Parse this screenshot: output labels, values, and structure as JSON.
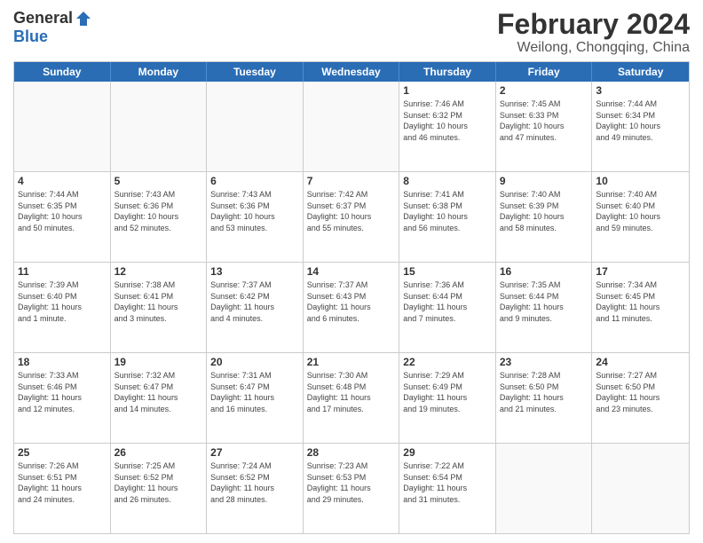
{
  "header": {
    "logo_general": "General",
    "logo_blue": "Blue",
    "title": "February 2024",
    "location": "Weilong, Chongqing, China"
  },
  "days_of_week": [
    "Sunday",
    "Monday",
    "Tuesday",
    "Wednesday",
    "Thursday",
    "Friday",
    "Saturday"
  ],
  "weeks": [
    [
      {
        "day": "",
        "info": ""
      },
      {
        "day": "",
        "info": ""
      },
      {
        "day": "",
        "info": ""
      },
      {
        "day": "",
        "info": ""
      },
      {
        "day": "1",
        "info": "Sunrise: 7:46 AM\nSunset: 6:32 PM\nDaylight: 10 hours\nand 46 minutes."
      },
      {
        "day": "2",
        "info": "Sunrise: 7:45 AM\nSunset: 6:33 PM\nDaylight: 10 hours\nand 47 minutes."
      },
      {
        "day": "3",
        "info": "Sunrise: 7:44 AM\nSunset: 6:34 PM\nDaylight: 10 hours\nand 49 minutes."
      }
    ],
    [
      {
        "day": "4",
        "info": "Sunrise: 7:44 AM\nSunset: 6:35 PM\nDaylight: 10 hours\nand 50 minutes."
      },
      {
        "day": "5",
        "info": "Sunrise: 7:43 AM\nSunset: 6:36 PM\nDaylight: 10 hours\nand 52 minutes."
      },
      {
        "day": "6",
        "info": "Sunrise: 7:43 AM\nSunset: 6:36 PM\nDaylight: 10 hours\nand 53 minutes."
      },
      {
        "day": "7",
        "info": "Sunrise: 7:42 AM\nSunset: 6:37 PM\nDaylight: 10 hours\nand 55 minutes."
      },
      {
        "day": "8",
        "info": "Sunrise: 7:41 AM\nSunset: 6:38 PM\nDaylight: 10 hours\nand 56 minutes."
      },
      {
        "day": "9",
        "info": "Sunrise: 7:40 AM\nSunset: 6:39 PM\nDaylight: 10 hours\nand 58 minutes."
      },
      {
        "day": "10",
        "info": "Sunrise: 7:40 AM\nSunset: 6:40 PM\nDaylight: 10 hours\nand 59 minutes."
      }
    ],
    [
      {
        "day": "11",
        "info": "Sunrise: 7:39 AM\nSunset: 6:40 PM\nDaylight: 11 hours\nand 1 minute."
      },
      {
        "day": "12",
        "info": "Sunrise: 7:38 AM\nSunset: 6:41 PM\nDaylight: 11 hours\nand 3 minutes."
      },
      {
        "day": "13",
        "info": "Sunrise: 7:37 AM\nSunset: 6:42 PM\nDaylight: 11 hours\nand 4 minutes."
      },
      {
        "day": "14",
        "info": "Sunrise: 7:37 AM\nSunset: 6:43 PM\nDaylight: 11 hours\nand 6 minutes."
      },
      {
        "day": "15",
        "info": "Sunrise: 7:36 AM\nSunset: 6:44 PM\nDaylight: 11 hours\nand 7 minutes."
      },
      {
        "day": "16",
        "info": "Sunrise: 7:35 AM\nSunset: 6:44 PM\nDaylight: 11 hours\nand 9 minutes."
      },
      {
        "day": "17",
        "info": "Sunrise: 7:34 AM\nSunset: 6:45 PM\nDaylight: 11 hours\nand 11 minutes."
      }
    ],
    [
      {
        "day": "18",
        "info": "Sunrise: 7:33 AM\nSunset: 6:46 PM\nDaylight: 11 hours\nand 12 minutes."
      },
      {
        "day": "19",
        "info": "Sunrise: 7:32 AM\nSunset: 6:47 PM\nDaylight: 11 hours\nand 14 minutes."
      },
      {
        "day": "20",
        "info": "Sunrise: 7:31 AM\nSunset: 6:47 PM\nDaylight: 11 hours\nand 16 minutes."
      },
      {
        "day": "21",
        "info": "Sunrise: 7:30 AM\nSunset: 6:48 PM\nDaylight: 11 hours\nand 17 minutes."
      },
      {
        "day": "22",
        "info": "Sunrise: 7:29 AM\nSunset: 6:49 PM\nDaylight: 11 hours\nand 19 minutes."
      },
      {
        "day": "23",
        "info": "Sunrise: 7:28 AM\nSunset: 6:50 PM\nDaylight: 11 hours\nand 21 minutes."
      },
      {
        "day": "24",
        "info": "Sunrise: 7:27 AM\nSunset: 6:50 PM\nDaylight: 11 hours\nand 23 minutes."
      }
    ],
    [
      {
        "day": "25",
        "info": "Sunrise: 7:26 AM\nSunset: 6:51 PM\nDaylight: 11 hours\nand 24 minutes."
      },
      {
        "day": "26",
        "info": "Sunrise: 7:25 AM\nSunset: 6:52 PM\nDaylight: 11 hours\nand 26 minutes."
      },
      {
        "day": "27",
        "info": "Sunrise: 7:24 AM\nSunset: 6:52 PM\nDaylight: 11 hours\nand 28 minutes."
      },
      {
        "day": "28",
        "info": "Sunrise: 7:23 AM\nSunset: 6:53 PM\nDaylight: 11 hours\nand 29 minutes."
      },
      {
        "day": "29",
        "info": "Sunrise: 7:22 AM\nSunset: 6:54 PM\nDaylight: 11 hours\nand 31 minutes."
      },
      {
        "day": "",
        "info": ""
      },
      {
        "day": "",
        "info": ""
      }
    ]
  ]
}
